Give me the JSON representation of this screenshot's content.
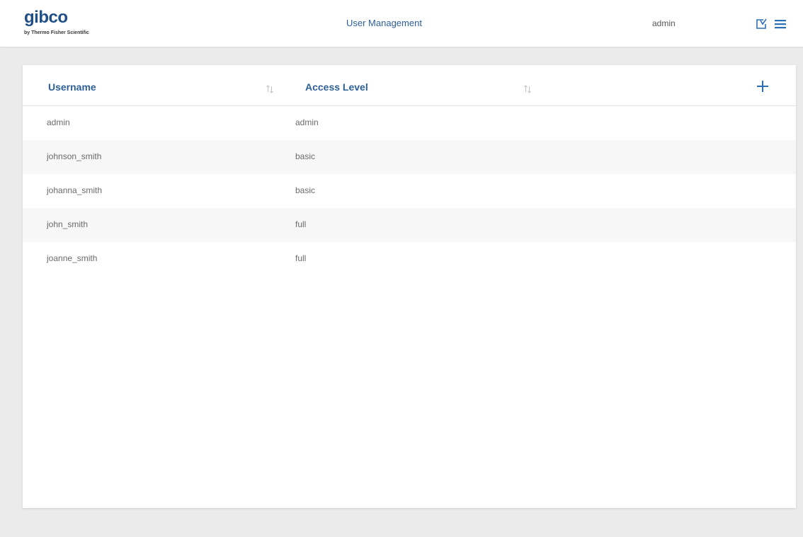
{
  "brand": {
    "logo_text": "gibco",
    "logo_subtext": "by Thermo Fisher Scientific",
    "color": "#1f4f86"
  },
  "header": {
    "title": "User Management",
    "current_user": "admin",
    "icons": [
      "logout-icon",
      "menu-icon"
    ],
    "accent_color": "#2d5f9a"
  },
  "table": {
    "columns": [
      {
        "label": "Username",
        "sort_icon": "sort-arrows-icon"
      },
      {
        "label": "Access Level",
        "sort_icon": "sort-arrows-icon"
      }
    ],
    "add_icon": "plus-icon",
    "rows": [
      {
        "username": "admin",
        "access": "admin"
      },
      {
        "username": "johnson_smith",
        "access": "basic"
      },
      {
        "username": "johanna_smith",
        "access": "basic"
      },
      {
        "username": "john_smith",
        "access": "full"
      },
      {
        "username": "joanne_smith",
        "access": "full"
      }
    ]
  }
}
